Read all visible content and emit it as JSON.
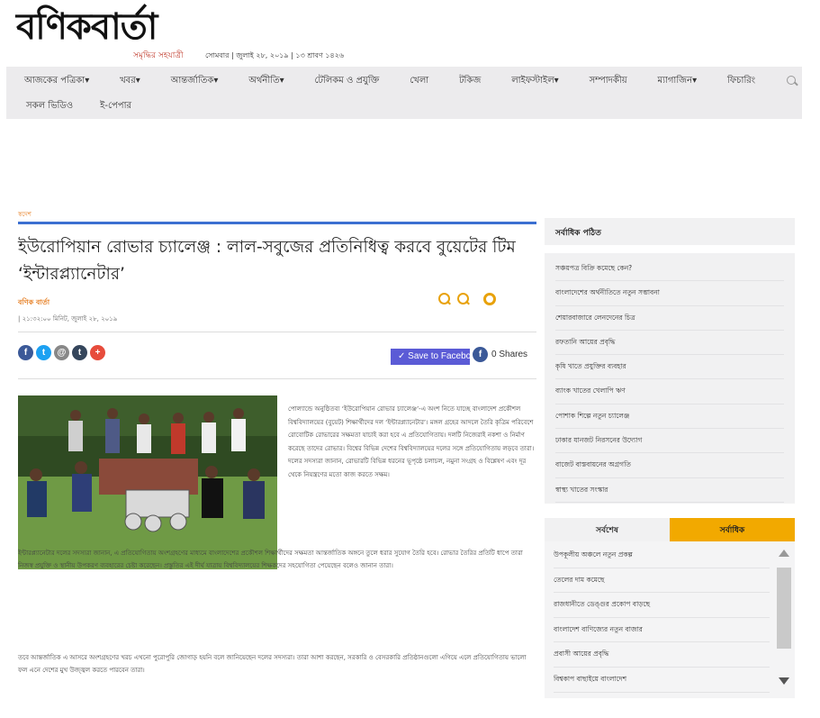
{
  "site": {
    "logo": "বণিকবার্তা",
    "tagline": "সমৃদ্ধির সহযাত্রী",
    "dateline": "সোমবার | জুলাই ২৮, ২০১৯ | ১৩ শ্রাবণ ১৪২৬"
  },
  "nav": {
    "row1": [
      "আজকের পত্রিকা▾",
      "খবর▾",
      "আন্তর্জাতিক▾",
      "অর্থনীতি▾",
      "টেলিকম ও প্রযুক্তি",
      "খেলা",
      "টকিজ",
      "লাইফস্টাইল▾",
      "সম্পাদকীয়",
      "ম্যাগাজিন▾",
      "ফিচারিং"
    ],
    "row2": [
      "সকল ভিডিও",
      "ই-পেপার"
    ]
  },
  "article": {
    "crumb": "স্বদেশ",
    "headline": "ইউরোপিয়ান রোভার চ্যালেঞ্জ : লাল-সবুজের প্রতিনিধিত্ব করবে বুয়েটের টিম ‘ইন্টারপ্ল্যানেটার’",
    "author": "বণিক বার্তা",
    "timestamp": "| ২১:৩২:০০ মিনিট, জুলাই ২৮, ২০১৯",
    "save_label": "✓ Save to Facebook",
    "share_count": "0 Shares",
    "fb_letter": "f",
    "photo_text": "পোল্যান্ডে অনুষ্ঠিতব্য ‘ইউরোপিয়ান রোভার চ্যালেঞ্জ’-এ অংশ নিতে যাচ্ছে বাংলাদেশ প্রকৌশল বিশ্ববিদ্যালয়ের (বুয়েট) শিক্ষার্থীদের দল ‘ইন্টারপ্ল্যানেটার’। মঙ্গল গ্রহের আদলে তৈরি কৃত্রিম পরিবেশে রোবোটিক রোভারের সক্ষমতা যাচাই করা হবে এ প্রতিযোগিতায়। দলটি নিজেরাই নকশা ও নির্মাণ করেছে তাদের রোভার। বিশ্বের বিভিন্ন দেশের বিশ্ববিদ্যালয়ের দলের সঙ্গে প্রতিযোগিতায় লড়বে তারা। দলের সদস্যরা জানান, রোভারটি বিভিন্ন ধরনের ভূপৃষ্ঠে চলাচল, নমুনা সংগ্রহ ও বিশ্লেষণ এবং দূর থেকে নিয়ন্ত্রণের মতো কাজ করতে সক্ষম।",
    "paragraph2": "ইন্টারপ্ল্যানেটার দলের সদস্যরা জানান, এ প্রতিযোগিতায় অংশগ্রহণের মাধ্যমে বাংলাদেশের প্রকৌশল শিক্ষার্থীদের সক্ষমতা আন্তর্জাতিক অঙ্গনে তুলে ধরার সুযোগ তৈরি হবে। রোভার তৈরির প্রতিটি ধাপে তারা নিজস্ব প্রযুক্তি ও স্থানীয় উপকরণ ব্যবহারের চেষ্টা করেছেন। প্রস্তুতির এই দীর্ঘ যাত্রায় বিশ্ববিদ্যালয়ের শিক্ষকদের সহযোগিতা পেয়েছেন বলেও জানান তারা।",
    "paragraph3": "তবে আন্তর্জাতিক এ আসরে অংশগ্রহণের খরচ এখনো পুরোপুরি জোগাড় হয়নি বলে জানিয়েছেন দলের সদস্যরা। তারা আশা করছেন, সরকারি ও বেসরকারি প্রতিষ্ঠানগুলো এগিয়ে এলে প্রতিযোগিতায় ভালো ফল এনে দেশের মুখ উজ্জ্বল করতে পারবেন তারা।"
  },
  "social": [
    {
      "name": "facebook",
      "glyph": "f",
      "color": "#3b5998"
    },
    {
      "name": "twitter",
      "glyph": "t",
      "color": "#1da1f2"
    },
    {
      "name": "email",
      "glyph": "@",
      "color": "#888888"
    },
    {
      "name": "tumblr",
      "glyph": "t",
      "color": "#35465c"
    },
    {
      "name": "more",
      "glyph": "+",
      "color": "#e74c3c"
    }
  ],
  "sidebar": {
    "most_read_title": "সর্বাধিক পঠিত",
    "most_read": [
      "সঞ্চয়পত্র বিক্রি কমেছে কেন?",
      "বাংলাদেশের অর্থনীতিতে নতুন সম্ভাবনা",
      "শেয়ারবাজারে লেনদেনের চিত্র",
      "রফতানি আয়ের প্রবৃদ্ধি",
      "কৃষি খাতে প্রযুক্তির ব্যবহার",
      "ব্যাংক খাতের খেলাপি ঋণ",
      "পোশাক শিল্পে নতুন চ্যালেঞ্জ",
      "ঢাকার যানজট নিরসনের উদ্যোগ",
      "বাজেট বাস্তবায়নের অগ্রগতি",
      "স্বাস্থ্য খাতের সংস্কার"
    ],
    "tabs": [
      "সর্বশেষ",
      "সর্বাধিক"
    ],
    "tab_items": [
      "উপকূলীয় অঞ্চলে নতুন প্রকল্প",
      "তেলের দাম কমেছে",
      "রাজধানীতে ডেঙ্গুর প্রকোপ বাড়ছে",
      "বাংলাদেশ বাণিজ্যের নতুন বাজার",
      "প্রবাসী আয়ের প্রবৃদ্ধি",
      "বিশ্বকাপ বাছাইয়ে বাংলাদেশ"
    ]
  }
}
